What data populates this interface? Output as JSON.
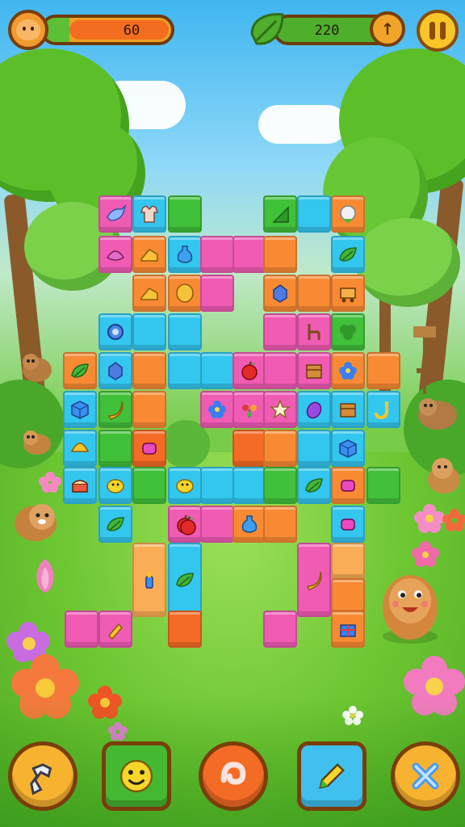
{
  "hud": {
    "left_value": "60",
    "left_progress": 0.2,
    "right_value": "220",
    "coin_symbol": "↑",
    "pause_label": "pause"
  },
  "colors": {
    "pink": "#f05bb4",
    "cyan": "#33c6ef",
    "green": "#41c03a",
    "orange": "#f98a34",
    "peach": "#fbac56",
    "dark_orange": "#f46b25"
  },
  "board": {
    "tiles": [
      {
        "color": "pink",
        "icon": "bird-icon"
      },
      {
        "color": "cyan",
        "icon": "shirt-icon"
      },
      {
        "color": "green",
        "icon": ""
      },
      {
        "color": "green",
        "icon": "triangle-icon"
      },
      {
        "color": "cyan",
        "icon": ""
      },
      {
        "color": "orange",
        "icon": "cauliflower-icon"
      },
      {
        "color": "pink",
        "icon": "dumpling-icon"
      },
      {
        "color": "orange",
        "icon": "cheese-icon"
      },
      {
        "color": "cyan",
        "icon": "potion-icon"
      },
      {
        "color": "pink",
        "icon": ""
      },
      {
        "color": "pink",
        "icon": ""
      },
      {
        "color": "orange",
        "icon": ""
      },
      {
        "color": "cyan",
        "icon": "leaf-icon"
      },
      {
        "color": "orange",
        "icon": "cheese-icon"
      },
      {
        "color": "orange",
        "icon": "egg-icon"
      },
      {
        "color": "pink",
        "icon": ""
      },
      {
        "color": "orange",
        "icon": "gem-icon"
      },
      {
        "color": "orange",
        "icon": ""
      },
      {
        "color": "orange",
        "icon": "cart-icon"
      },
      {
        "color": "cyan",
        "icon": "gear-icon"
      },
      {
        "color": "cyan",
        "icon": ""
      },
      {
        "color": "cyan",
        "icon": ""
      },
      {
        "color": "pink",
        "icon": ""
      },
      {
        "color": "pink",
        "icon": "chair-icon"
      },
      {
        "color": "green",
        "icon": "clover-icon"
      },
      {
        "color": "orange",
        "icon": "leaf-icon"
      },
      {
        "color": "cyan",
        "icon": "gem-icon"
      },
      {
        "color": "orange",
        "icon": ""
      },
      {
        "color": "cyan",
        "icon": ""
      },
      {
        "color": "cyan",
        "icon": ""
      },
      {
        "color": "pink",
        "icon": "apple-icon"
      },
      {
        "color": "pink",
        "icon": ""
      },
      {
        "color": "pink",
        "icon": "box-icon"
      },
      {
        "color": "orange",
        "icon": "flower-icon"
      },
      {
        "color": "orange",
        "icon": ""
      },
      {
        "color": "cyan",
        "icon": "cube-icon"
      },
      {
        "color": "green",
        "icon": "banana-icon"
      },
      {
        "color": "orange",
        "icon": ""
      },
      {
        "color": "pink",
        "icon": "flower-icon"
      },
      {
        "color": "pink",
        "icon": "sprout-icon"
      },
      {
        "color": "pink",
        "icon": "star-icon"
      },
      {
        "color": "cyan",
        "icon": "eggplant-icon"
      },
      {
        "color": "cyan",
        "icon": "box-icon"
      },
      {
        "color": "cyan",
        "icon": "hook-icon"
      },
      {
        "color": "cyan",
        "icon": "shell-icon"
      },
      {
        "color": "green",
        "icon": ""
      },
      {
        "color": "dkorange",
        "icon": "candy-icon"
      },
      {
        "color": "dkorange",
        "icon": ""
      },
      {
        "color": "orange",
        "icon": ""
      },
      {
        "color": "cyan",
        "icon": ""
      },
      {
        "color": "cyan",
        "icon": "cube-icon"
      },
      {
        "color": "cyan",
        "icon": "cake-icon"
      },
      {
        "color": "cyan",
        "icon": "chick-icon"
      },
      {
        "color": "green",
        "icon": ""
      },
      {
        "color": "cyan",
        "icon": "chick-icon"
      },
      {
        "color": "cyan",
        "icon": ""
      },
      {
        "color": "cyan",
        "icon": ""
      },
      {
        "color": "green",
        "icon": ""
      },
      {
        "color": "cyan",
        "icon": "leaf-icon"
      },
      {
        "color": "orange",
        "icon": "candy-icon"
      },
      {
        "color": "green",
        "icon": ""
      },
      {
        "color": "cyan",
        "icon": "leaf-icon"
      },
      {
        "color": "pink",
        "icon": "apple-icon"
      },
      {
        "color": "pink",
        "icon": ""
      },
      {
        "color": "orange",
        "icon": "potion-icon"
      },
      {
        "color": "orange",
        "icon": ""
      },
      {
        "color": "cyan",
        "icon": "candy-icon"
      },
      {
        "color": "peach",
        "icon": "bottle-icon"
      },
      {
        "color": "cyan",
        "icon": "leaf-icon"
      },
      {
        "color": "pink",
        "icon": "banana-icon"
      },
      {
        "color": "peach",
        "icon": ""
      },
      {
        "color": "orange",
        "icon": ""
      },
      {
        "color": "pink",
        "icon": ""
      },
      {
        "color": "pink",
        "icon": "brush-icon"
      },
      {
        "color": "dkorange",
        "icon": ""
      },
      {
        "color": "pink",
        "icon": ""
      },
      {
        "color": "orange",
        "icon": "present-icon"
      },
      {
        "color": "orange",
        "icon": "apple-icon"
      }
    ]
  },
  "powerups": [
    {
      "name": "hammer-icon",
      "color": "#f7b330"
    },
    {
      "name": "smiley-icon",
      "color": "#45b832"
    },
    {
      "name": "magnet-icon",
      "color": "#f46b25"
    },
    {
      "name": "pencil-icon",
      "color": "#3fc0ef"
    },
    {
      "name": "close-icon",
      "color": "#f7b330"
    }
  ]
}
